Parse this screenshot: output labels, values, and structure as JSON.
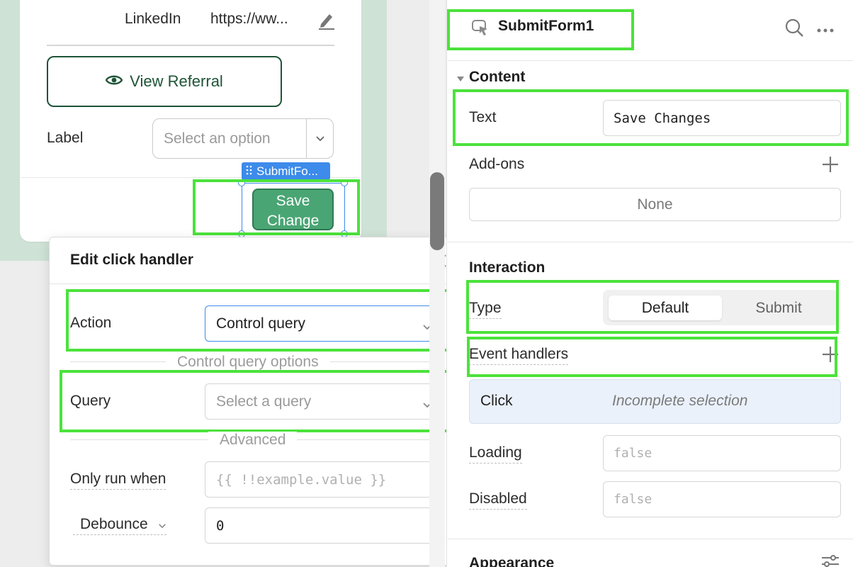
{
  "canvas": {
    "linkedin_label": "LinkedIn",
    "linkedin_value": "https://ww...",
    "view_referral_label": "View Referral",
    "select_label": "Label",
    "select_placeholder": "Select an option",
    "component_tag": "SubmitFo...",
    "save_button_line1": "Save",
    "save_button_line2": "Change"
  },
  "popover": {
    "title": "Edit click handler",
    "action_label": "Action",
    "action_value": "Control query",
    "section_options": "Control query options",
    "query_label": "Query",
    "query_placeholder": "Select a query",
    "section_advanced": "Advanced",
    "only_run_when_label": "Only run when",
    "only_run_when_placeholder": "{{ !!example.value }}",
    "debounce_label": "Debounce",
    "debounce_value": "0"
  },
  "inspector": {
    "component_name": "SubmitForm1",
    "content_heading": "Content",
    "text_label": "Text",
    "text_value": "Save Changes",
    "addons_label": "Add-ons",
    "addons_value": "None",
    "interaction_heading": "Interaction",
    "type_label": "Type",
    "type_options": [
      "Default",
      "Submit"
    ],
    "type_selected": "Default",
    "event_handlers_label": "Event handlers",
    "event_handler": {
      "event": "Click",
      "status": "Incomplete selection"
    },
    "loading_label": "Loading",
    "loading_placeholder": "false",
    "disabled_label": "Disabled",
    "disabled_placeholder": "false",
    "appearance_heading": "Appearance"
  },
  "colors": {
    "highlight": "#4ce23c",
    "selection": "#3d8bea",
    "button_green": "#4aa574",
    "frame_green": "#cfe2d6",
    "event_row_bg": "#eaf1fb"
  }
}
